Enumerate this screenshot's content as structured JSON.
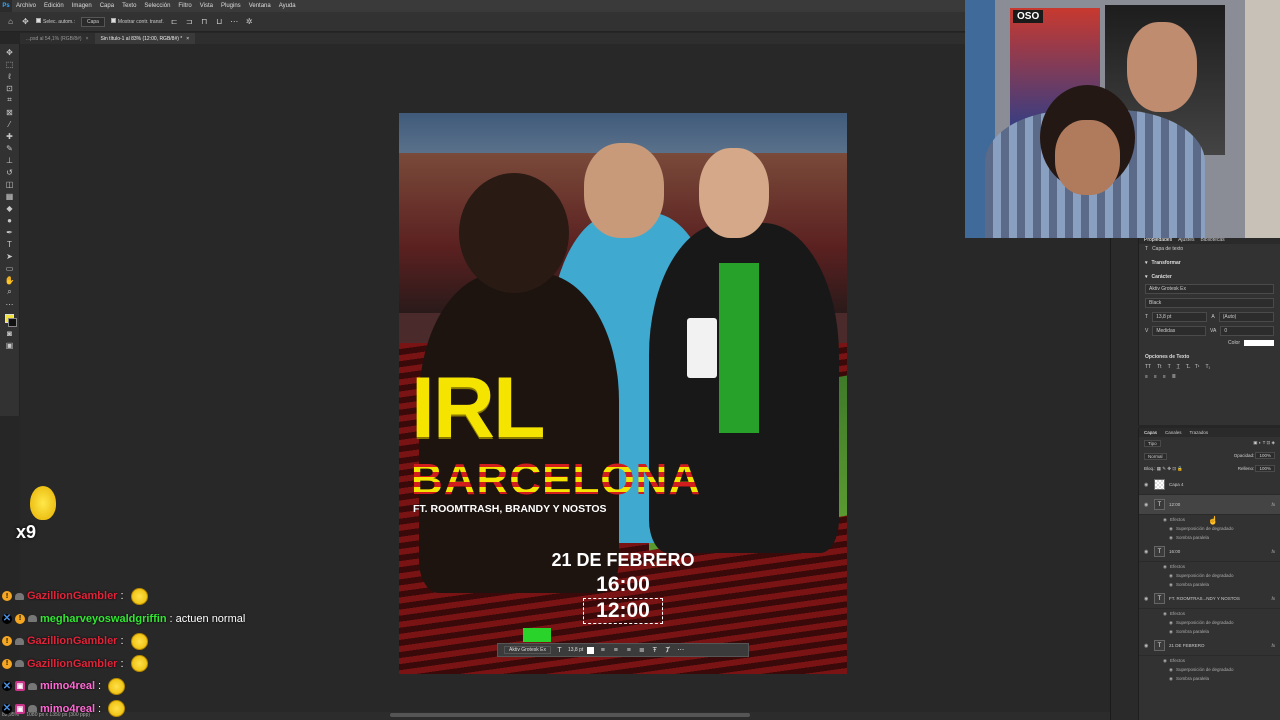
{
  "menubar": {
    "logo": "Ps",
    "items": [
      "Archivo",
      "Edición",
      "Imagen",
      "Capa",
      "Texto",
      "Selección",
      "Filtro",
      "Vista",
      "Plugins",
      "Ventana",
      "Ayuda"
    ]
  },
  "optionsbar": {
    "auto_select_label": "Selec. autom.:",
    "auto_select_value": "Capa",
    "show_transform_label": "Mostrar contr. transf."
  },
  "tabs": [
    {
      "label": "...psd al 54,1% (RGB/8#)",
      "active": false
    },
    {
      "label": "Sin título-1 al 83% (12:00, RGB/8#) *",
      "active": true
    }
  ],
  "poster": {
    "headline": "IRL",
    "city": "BARCELONA",
    "featuring": "FT. ROOMTRASH, BRANDY Y NOSTOS",
    "date": "21 DE FEBRERO",
    "time1": "16:00",
    "time2": "12:00"
  },
  "textbar": {
    "font": "Aktiv Grotesk Ex",
    "size": "13,8 pt"
  },
  "status": {
    "zoom": "82,95%",
    "doc": "1080 px x 1350 px (300 ppp)"
  },
  "properties": {
    "tabs": [
      "Propiedades",
      "Ajustes",
      "Bibliotecas"
    ],
    "layer_type": "Capa de texto",
    "transform_label": "Transformar",
    "character_label": "Carácter",
    "font_family": "Aktiv Grotesk Ex",
    "font_style": "Black",
    "font_size": "13,8 pt",
    "leading": "(Auto)",
    "kerning": "Medidas",
    "tracking": "0",
    "color_label": "Color",
    "color": "#ffffff",
    "text_options_label": "Opciones de Texto"
  },
  "layers": {
    "tabs": [
      "Capas",
      "Canales",
      "Trazados"
    ],
    "filter": "Tipo",
    "blend": "Normal",
    "opacity_label": "Opacidad:",
    "opacity": "100%",
    "lock_label": "Bloq.:",
    "fill_label": "Relleno:",
    "fill": "100%",
    "items": [
      {
        "name": "Capa 4",
        "type": "pixel",
        "selected": false,
        "fx": false,
        "effects": []
      },
      {
        "name": "12:00",
        "type": "text",
        "selected": true,
        "fx": true,
        "effects": [
          "Efectos",
          "Superposición de degradado",
          "Sombra paralela"
        ]
      },
      {
        "name": "16:00",
        "type": "text",
        "selected": false,
        "fx": true,
        "effects": [
          "Efectos",
          "Superposición de degradado",
          "Sombra paralela"
        ]
      },
      {
        "name": "FT. ROOMTRAS...NDY Y NOSTOS",
        "type": "text",
        "selected": false,
        "fx": true,
        "effects": [
          "Efectos",
          "Superposición de degradado",
          "Sombra paralela"
        ]
      },
      {
        "name": "21 DE FEBRERO",
        "type": "text",
        "selected": false,
        "fx": true,
        "effects": [
          "Efectos",
          "Superposición de degradado",
          "Sombra paralela"
        ]
      }
    ]
  },
  "webcam": {
    "sign_text": "OSO"
  },
  "combo": {
    "count": "x9"
  },
  "chat": [
    {
      "user": "GazillionGambler",
      "color": "#e0243a",
      "badges": [
        "orange",
        "hat"
      ],
      "text": "",
      "emote": true
    },
    {
      "user": "megharveyoswaldgriffin",
      "color": "#33e633",
      "badges": [
        "mod",
        "orange",
        "hat"
      ],
      "text": "actuen normal",
      "emote": false
    },
    {
      "user": "GazillionGambler",
      "color": "#e0243a",
      "badges": [
        "orange",
        "hat"
      ],
      "text": "",
      "emote": true
    },
    {
      "user": "GazillionGambler",
      "color": "#e0243a",
      "badges": [
        "orange",
        "hat"
      ],
      "text": "",
      "emote": true
    },
    {
      "user": "mimo4real",
      "color": "#ff69d4",
      "badges": [
        "mod",
        "pink",
        "hat"
      ],
      "text": "",
      "emote": true
    },
    {
      "user": "mimo4real",
      "color": "#ff69d4",
      "badges": [
        "mod",
        "pink",
        "hat"
      ],
      "text": "",
      "emote": true
    }
  ]
}
